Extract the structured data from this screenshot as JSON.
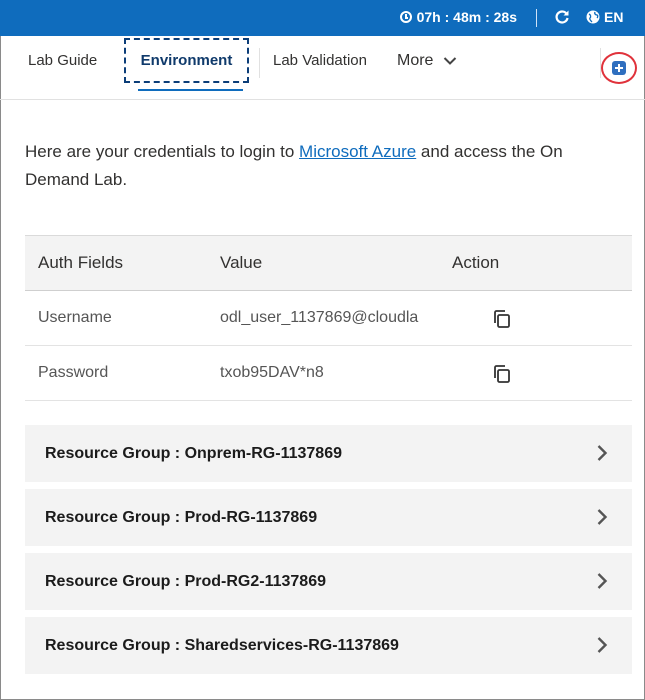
{
  "topbar": {
    "timer": "07h : 48m : 28s",
    "language": "EN",
    "clock_icon": "clock-icon",
    "refresh_icon": "refresh-icon",
    "globe_icon": "globe-icon",
    "background_color": "#0f6cbd"
  },
  "tabs": {
    "items": [
      {
        "label": "Lab Guide"
      },
      {
        "label": "Environment",
        "selected": true
      },
      {
        "label": "Lab Validation"
      },
      {
        "label": "More"
      }
    ],
    "more_icon": "chevron-down-icon",
    "expand_icon": "expand-icon"
  },
  "intro": {
    "text_before": "Here are your credentials to login to ",
    "link": "Microsoft Azure",
    "text_after": " and access the On Demand Lab."
  },
  "credentials": {
    "headers": [
      "Auth Fields",
      "Value",
      "Action"
    ],
    "rows": [
      {
        "field": "Username",
        "value": "odl_user_1137869@cloudla",
        "action_icon": "copy-icon"
      },
      {
        "field": "Password",
        "value": "txob95DAV*n8",
        "action_icon": "copy-icon"
      }
    ]
  },
  "resource_groups": [
    {
      "label": "Resource Group : Onprem-RG-1137869"
    },
    {
      "label": "Resource Group : Prod-RG-1137869"
    },
    {
      "label": "Resource Group : Prod-RG2-1137869"
    },
    {
      "label": "Resource Group : Sharedservices-RG-1137869"
    }
  ],
  "colors": {
    "accent": "#0f6cbd",
    "focus_outline": "#0b3d78",
    "highlight_circle": "#e0323b"
  }
}
